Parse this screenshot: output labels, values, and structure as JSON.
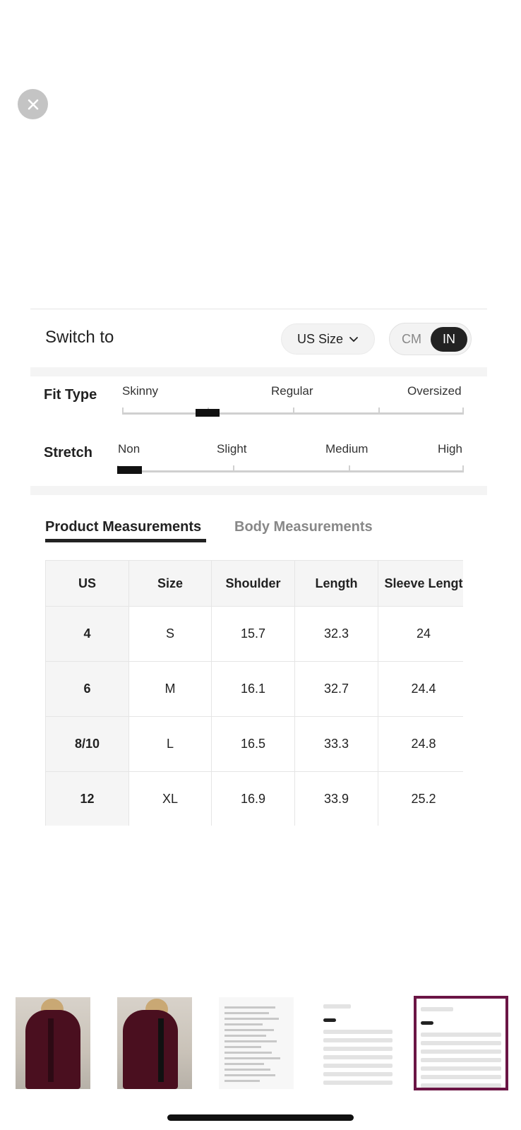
{
  "switch": {
    "label": "Switch to",
    "size_system": "US Size",
    "units": [
      "CM",
      "IN"
    ],
    "selected_unit": "IN"
  },
  "fit_type": {
    "title": "Fit Type",
    "options": [
      "Skinny",
      "Regular",
      "Oversized"
    ],
    "level": 0.25
  },
  "stretch": {
    "title": "Stretch",
    "options": [
      "Non",
      "Slight",
      "Medium",
      "High"
    ],
    "level": 0.0
  },
  "tabs": {
    "product": "Product Measurements",
    "body": "Body Measurements",
    "active": "product"
  },
  "table": {
    "headers": [
      "US",
      "Size",
      "Shoulder",
      "Length",
      "Sleeve Lengt"
    ],
    "rows": [
      [
        "4",
        "S",
        "15.7",
        "32.3",
        "24"
      ],
      [
        "6",
        "M",
        "16.1",
        "32.7",
        "24.4"
      ],
      [
        "8/10",
        "L",
        "16.5",
        "33.3",
        "24.8"
      ],
      [
        "12",
        "XL",
        "16.9",
        "33.9",
        "25.2"
      ]
    ]
  },
  "thumbnails": {
    "count": 5,
    "selected_index": 4
  },
  "colors": {
    "accent": "#6b1545",
    "coat": "#4a0f1f"
  }
}
